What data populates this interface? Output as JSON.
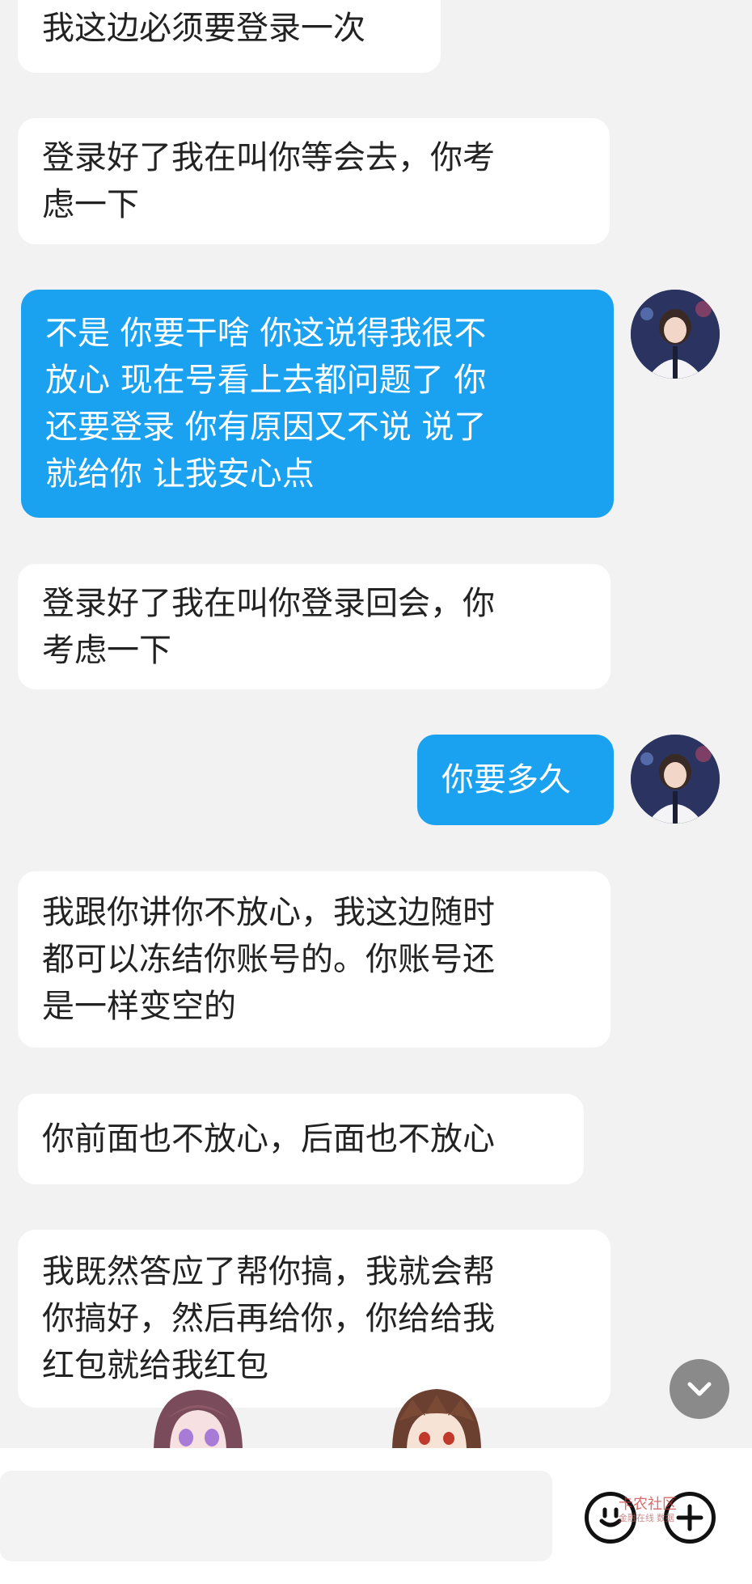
{
  "messages": [
    {
      "direction": "incoming",
      "text": "我这边必须要登录一次"
    },
    {
      "direction": "incoming",
      "text": "登录好了我在叫你等会去，你考\n虑一下"
    },
    {
      "direction": "outgoing",
      "text": "不是 你要干啥 你这说得我很不\n放心 现在号看上去都问题了 你\n还要登录 你有原因又不说 说了\n就给你 让我安心点"
    },
    {
      "direction": "incoming",
      "text": "登录好了我在叫你登录回会，你\n考虑一下"
    },
    {
      "direction": "outgoing",
      "text": "你要多久"
    },
    {
      "direction": "incoming",
      "text": "我跟你讲你不放心，我这边随时\n都可以冻结你账号的。你账号还\n是一样变空的"
    },
    {
      "direction": "incoming",
      "text": "你前面也不放心，后面也不放心"
    },
    {
      "direction": "incoming",
      "text": "我既然答应了帮你搞，我就会帮\n你搞好，然后再给你，你给给我\n红包就给我红包"
    }
  ],
  "colors": {
    "background": "#f2f2f2",
    "incoming_bubble": "#ffffff",
    "outgoing_bubble": "#1aa2f0"
  },
  "icons": {
    "scroll_down": "chevron-down-icon",
    "emoji": "emoji-icon",
    "add": "plus-icon"
  },
  "watermark": {
    "text": "卡农社区",
    "subtext": "金融在线 数据"
  }
}
